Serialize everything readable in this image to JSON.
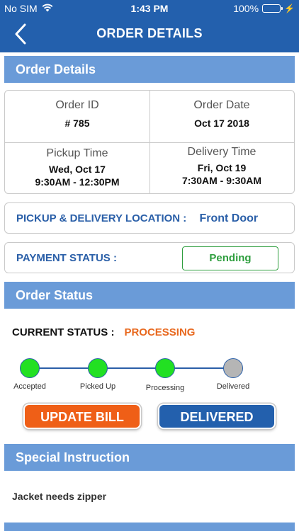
{
  "status_bar": {
    "carrier": "No SIM",
    "time": "1:43 PM",
    "battery": "100%"
  },
  "nav": {
    "title": "ORDER DETAILS"
  },
  "sections": {
    "order_details": "Order Details",
    "order_status": "Order Status",
    "special_instruction": "Special Instruction"
  },
  "order": {
    "order_id_label": "Order ID",
    "order_id": "# 785",
    "order_date_label": "Order Date",
    "order_date": "Oct 17 2018",
    "pickup_label": "Pickup Time",
    "pickup_day": "Wed, Oct 17",
    "pickup_window": "9:30AM - 12:30PM",
    "delivery_label": "Delivery Time",
    "delivery_day": "Fri, Oct 19",
    "delivery_window": "7:30AM - 9:30AM"
  },
  "location": {
    "label": "PICKUP & DELIVERY LOCATION :",
    "value": "Front Door"
  },
  "payment": {
    "label": "PAYMENT STATUS :",
    "value": "Pending"
  },
  "current_status": {
    "label": "CURRENT STATUS :",
    "value": "PROCESSING"
  },
  "steps": [
    {
      "label": "Accepted",
      "done": true
    },
    {
      "label": "Picked Up",
      "done": true
    },
    {
      "label": "Processing",
      "done": true
    },
    {
      "label": "Delivered",
      "done": false
    }
  ],
  "buttons": {
    "update_bill": "UPDATE BILL",
    "delivered": "DELIVERED"
  },
  "instruction": {
    "text": "Jacket needs zipper"
  },
  "colors": {
    "brand_blue": "#2360ad",
    "section_blue": "#6a9bd8",
    "accent_orange": "#ef5f17",
    "status_green": "#22e022",
    "pending_green": "#2e9e3e",
    "inactive_gray": "#b5b5b5"
  }
}
